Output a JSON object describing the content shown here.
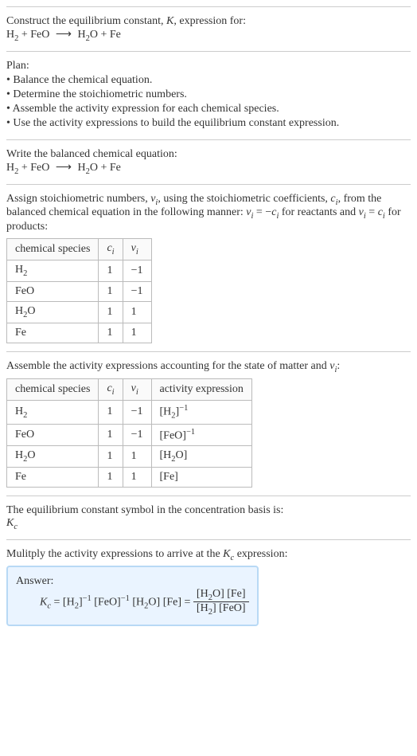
{
  "intro": {
    "line1": "Construct the equilibrium constant, ",
    "k": "K",
    "line1b": ", expression for:",
    "eq_lhs1": "H",
    "eq_lhs2": " + FeO ",
    "arrow": "⟶",
    "eq_rhs": " H",
    "eq_rhs2": "O + Fe"
  },
  "plan": {
    "title": "Plan:",
    "b1": "• Balance the chemical equation.",
    "b2": "• Determine the stoichiometric numbers.",
    "b3": "• Assemble the activity expression for each chemical species.",
    "b4": "• Use the activity expressions to build the equilibrium constant expression."
  },
  "balanced": {
    "title": "Write the balanced chemical equation:",
    "lhs1": "H",
    "lhs2": " + FeO ",
    "arrow": "⟶",
    "rhs1": " H",
    "rhs2": "O + Fe"
  },
  "stoich": {
    "text1": "Assign stoichiometric numbers, ",
    "nu": "ν",
    "i": "i",
    "text2": ", using the stoichiometric coefficients, ",
    "c": "c",
    "text3": ", from the balanced chemical equation in the following manner: ",
    "eq1a": " = −",
    "text4": " for reactants and ",
    "eq2a": " = ",
    "text5": " for products:",
    "headers": {
      "h1": "chemical species",
      "h2": "c",
      "h3": "ν"
    },
    "rows": [
      {
        "species": "H",
        "sub": "2",
        "c": "1",
        "nu": "−1"
      },
      {
        "species": "FeO",
        "sub": "",
        "c": "1",
        "nu": "−1"
      },
      {
        "species": "H",
        "sub": "2",
        "extra": "O",
        "c": "1",
        "nu": "1"
      },
      {
        "species": "Fe",
        "sub": "",
        "c": "1",
        "nu": "1"
      }
    ]
  },
  "activity": {
    "title": "Assemble the activity expressions accounting for the state of matter and ",
    "nu": "ν",
    "i": "i",
    "colon": ":",
    "headers": {
      "h1": "chemical species",
      "h2": "c",
      "h3": "ν",
      "h4": "activity expression"
    },
    "rows": [
      {
        "species": "H",
        "sub": "2",
        "c": "1",
        "nu": "−1",
        "act": "[H",
        "actsub": "2",
        "actend": "]",
        "exp": "−1"
      },
      {
        "species": "FeO",
        "sub": "",
        "c": "1",
        "nu": "−1",
        "act": "[FeO]",
        "actsub": "",
        "actend": "",
        "exp": "−1"
      },
      {
        "species": "H",
        "sub": "2",
        "extra": "O",
        "c": "1",
        "nu": "1",
        "act": "[H",
        "actsub": "2",
        "actend": "O]",
        "exp": ""
      },
      {
        "species": "Fe",
        "sub": "",
        "c": "1",
        "nu": "1",
        "act": "[Fe]",
        "actsub": "",
        "actend": "",
        "exp": ""
      }
    ]
  },
  "symbol": {
    "text": "The equilibrium constant symbol in the concentration basis is:",
    "kc": "K",
    "c": "c"
  },
  "multiply": {
    "text1": "Mulitply the activity expressions to arrive at the ",
    "kc": "K",
    "c": "c",
    "text2": " expression:"
  },
  "answer": {
    "label": "Answer:",
    "kc": "K",
    "c": "c",
    "eq": " = [H",
    "p1": "]",
    "e1": "−1",
    "p2": " [FeO]",
    "e2": "−1",
    "p3": " [H",
    "p4": "O] [Fe] = ",
    "num1": "[H",
    "num2": "O] [Fe]",
    "den1": "[H",
    "den2": "] [FeO]"
  }
}
